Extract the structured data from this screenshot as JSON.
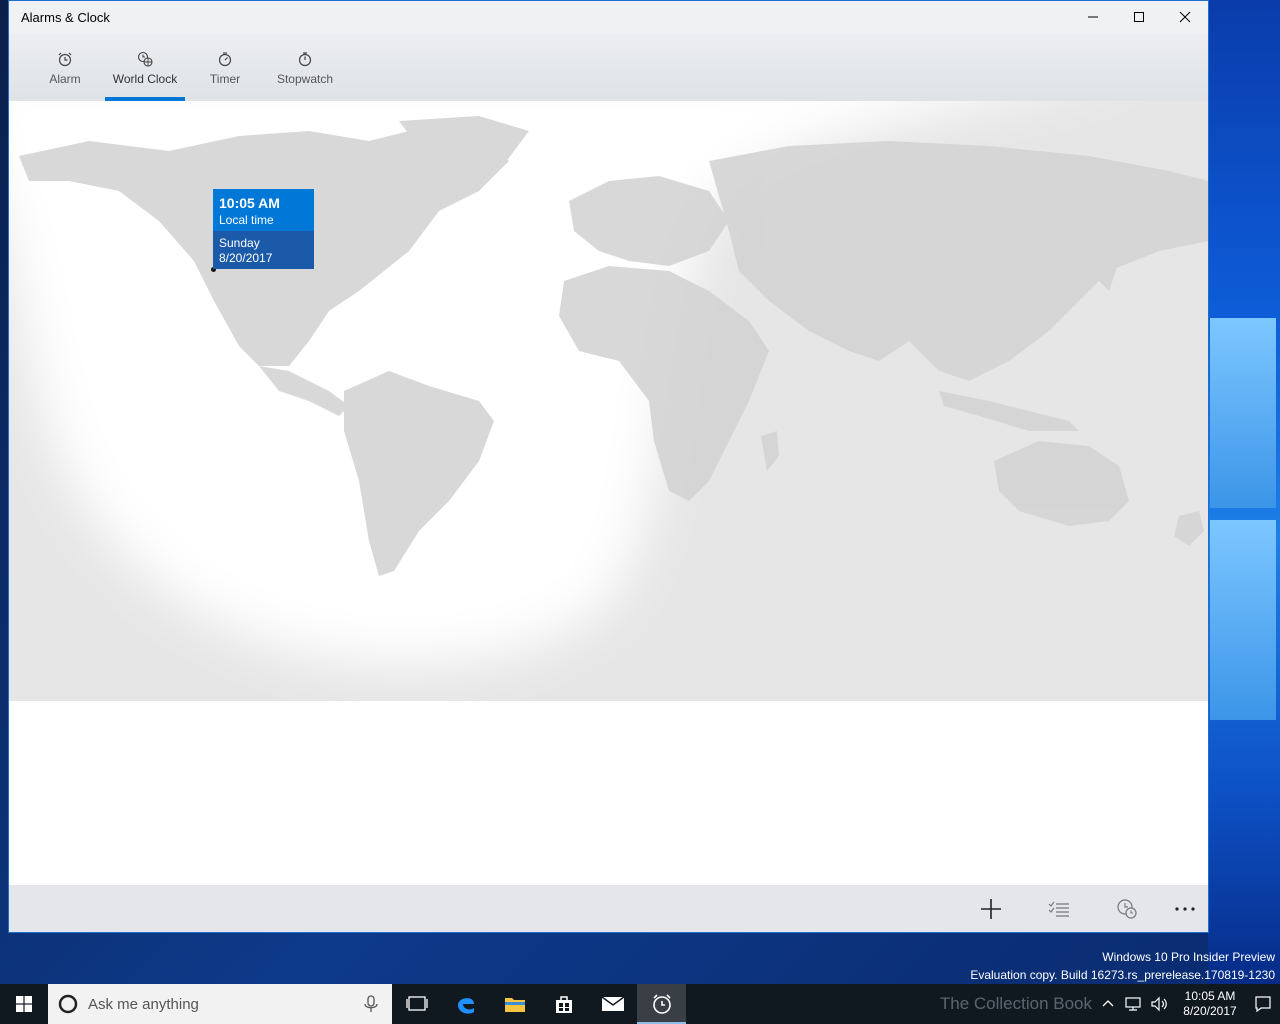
{
  "window": {
    "title": "Alarms & Clock",
    "caption": {
      "minimize": "minimize-icon",
      "maximize": "maximize-icon",
      "close": "close-icon"
    }
  },
  "tabs": [
    {
      "label": "Alarm",
      "icon": "alarm-clock-icon"
    },
    {
      "label": "World Clock",
      "icon": "globe-clock-icon",
      "active": true
    },
    {
      "label": "Timer",
      "icon": "timer-icon"
    },
    {
      "label": "Stopwatch",
      "icon": "stopwatch-icon"
    }
  ],
  "map": {
    "tooltip": {
      "time": "10:05 AM",
      "label": "Local time",
      "day": "Sunday",
      "date": "8/20/2017"
    }
  },
  "commands": [
    {
      "name": "add",
      "icon": "plus-icon"
    },
    {
      "name": "select",
      "icon": "checklist-icon"
    },
    {
      "name": "compare",
      "icon": "compare-clock-icon"
    },
    {
      "name": "more",
      "icon": "more-icon"
    }
  ],
  "desktop": {
    "build_line1": "Windows 10 Pro Insider Preview",
    "build_line2": "Evaluation copy. Build 16273.rs_prerelease.170819-1230",
    "watermark": "The Collection Book"
  },
  "taskbar": {
    "search_placeholder": "Ask me anything",
    "clock_time": "10:05 AM",
    "clock_date": "8/20/2017"
  },
  "colors": {
    "accent": "#0078d7",
    "tooltip_bottom": "#1a5aa8",
    "land": "#dcdcdc",
    "night": "#e6e6e6"
  }
}
